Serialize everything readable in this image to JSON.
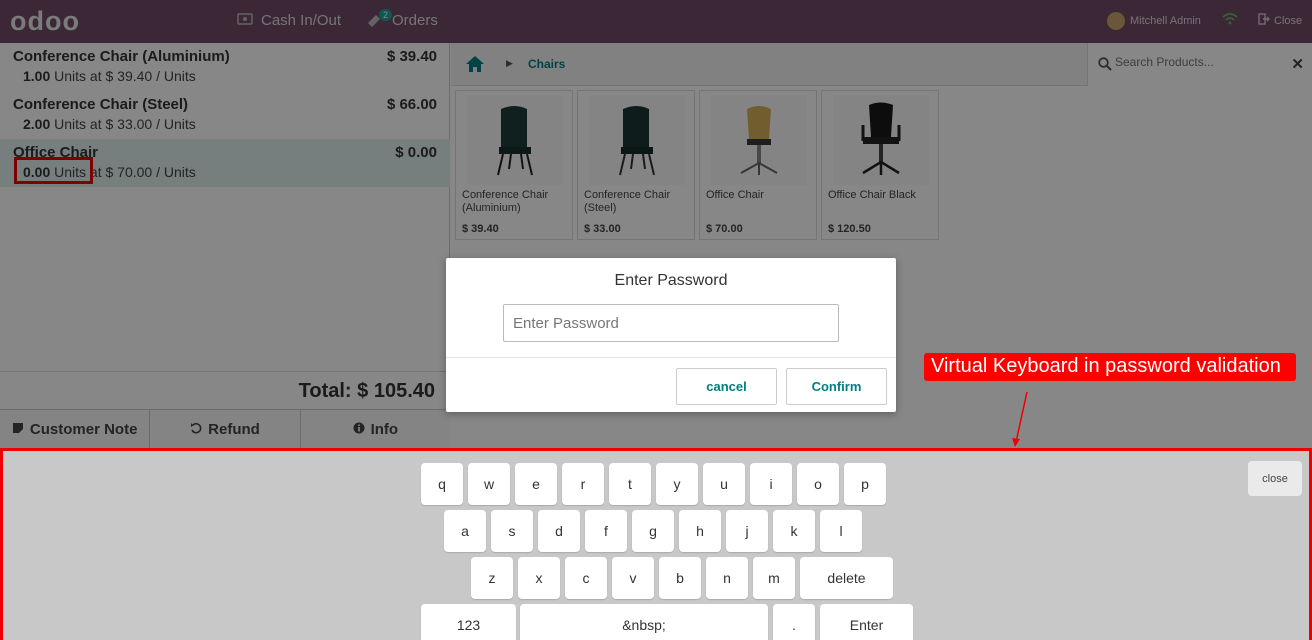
{
  "topbar": {
    "logo": "odoo",
    "cash_label": "Cash In/Out",
    "orders_label": "Orders",
    "orders_count": "2",
    "user_name": "Mitchell Admin",
    "close_label": "Close"
  },
  "order": {
    "lines": [
      {
        "name": "Conference Chair (Aluminium)",
        "price": "$ 39.40",
        "qty": "1.00",
        "info": " Units at $ 39.40 / Units"
      },
      {
        "name": "Conference Chair (Steel)",
        "price": "$ 66.00",
        "qty": "2.00",
        "info": " Units at $ 33.00 / Units"
      },
      {
        "name": "Office Chair",
        "price": "$ 0.00",
        "qty": "0.00",
        "info": " Units at $ 70.00 / Units"
      }
    ],
    "total": "Total: $ 105.40"
  },
  "controls": {
    "customer_note": "Customer Note",
    "refund": "Refund",
    "info": "Info"
  },
  "products": {
    "breadcrumb": "Chairs",
    "search_placeholder": "Search Products...",
    "items": [
      {
        "name": "Conference Chair (Aluminium)",
        "price": "$ 39.40"
      },
      {
        "name": "Conference Chair (Steel)",
        "price": "$ 33.00"
      },
      {
        "name": "Office Chair",
        "price": "$ 70.00"
      },
      {
        "name": "Office Chair Black",
        "price": "$ 120.50"
      }
    ]
  },
  "dialog": {
    "title": "Enter Password",
    "placeholder": "Enter Password",
    "cancel": "cancel",
    "confirm": "Confirm"
  },
  "annotation": "Virtual Keyboard in password validation",
  "keyboard": {
    "row1": [
      "q",
      "w",
      "e",
      "r",
      "t",
      "y",
      "u",
      "i",
      "o",
      "p"
    ],
    "row2": [
      "a",
      "s",
      "d",
      "f",
      "g",
      "h",
      "j",
      "k",
      "l"
    ],
    "row3": [
      "z",
      "x",
      "c",
      "v",
      "b",
      "n",
      "m"
    ],
    "delete": "delete",
    "numbers": "123",
    "space": "&nbsp;",
    "dot": ".",
    "enter": "Enter",
    "close": "close"
  },
  "colors": {
    "topbar": "#714b67",
    "accent": "#017e84",
    "highlight": "#ff0000"
  }
}
